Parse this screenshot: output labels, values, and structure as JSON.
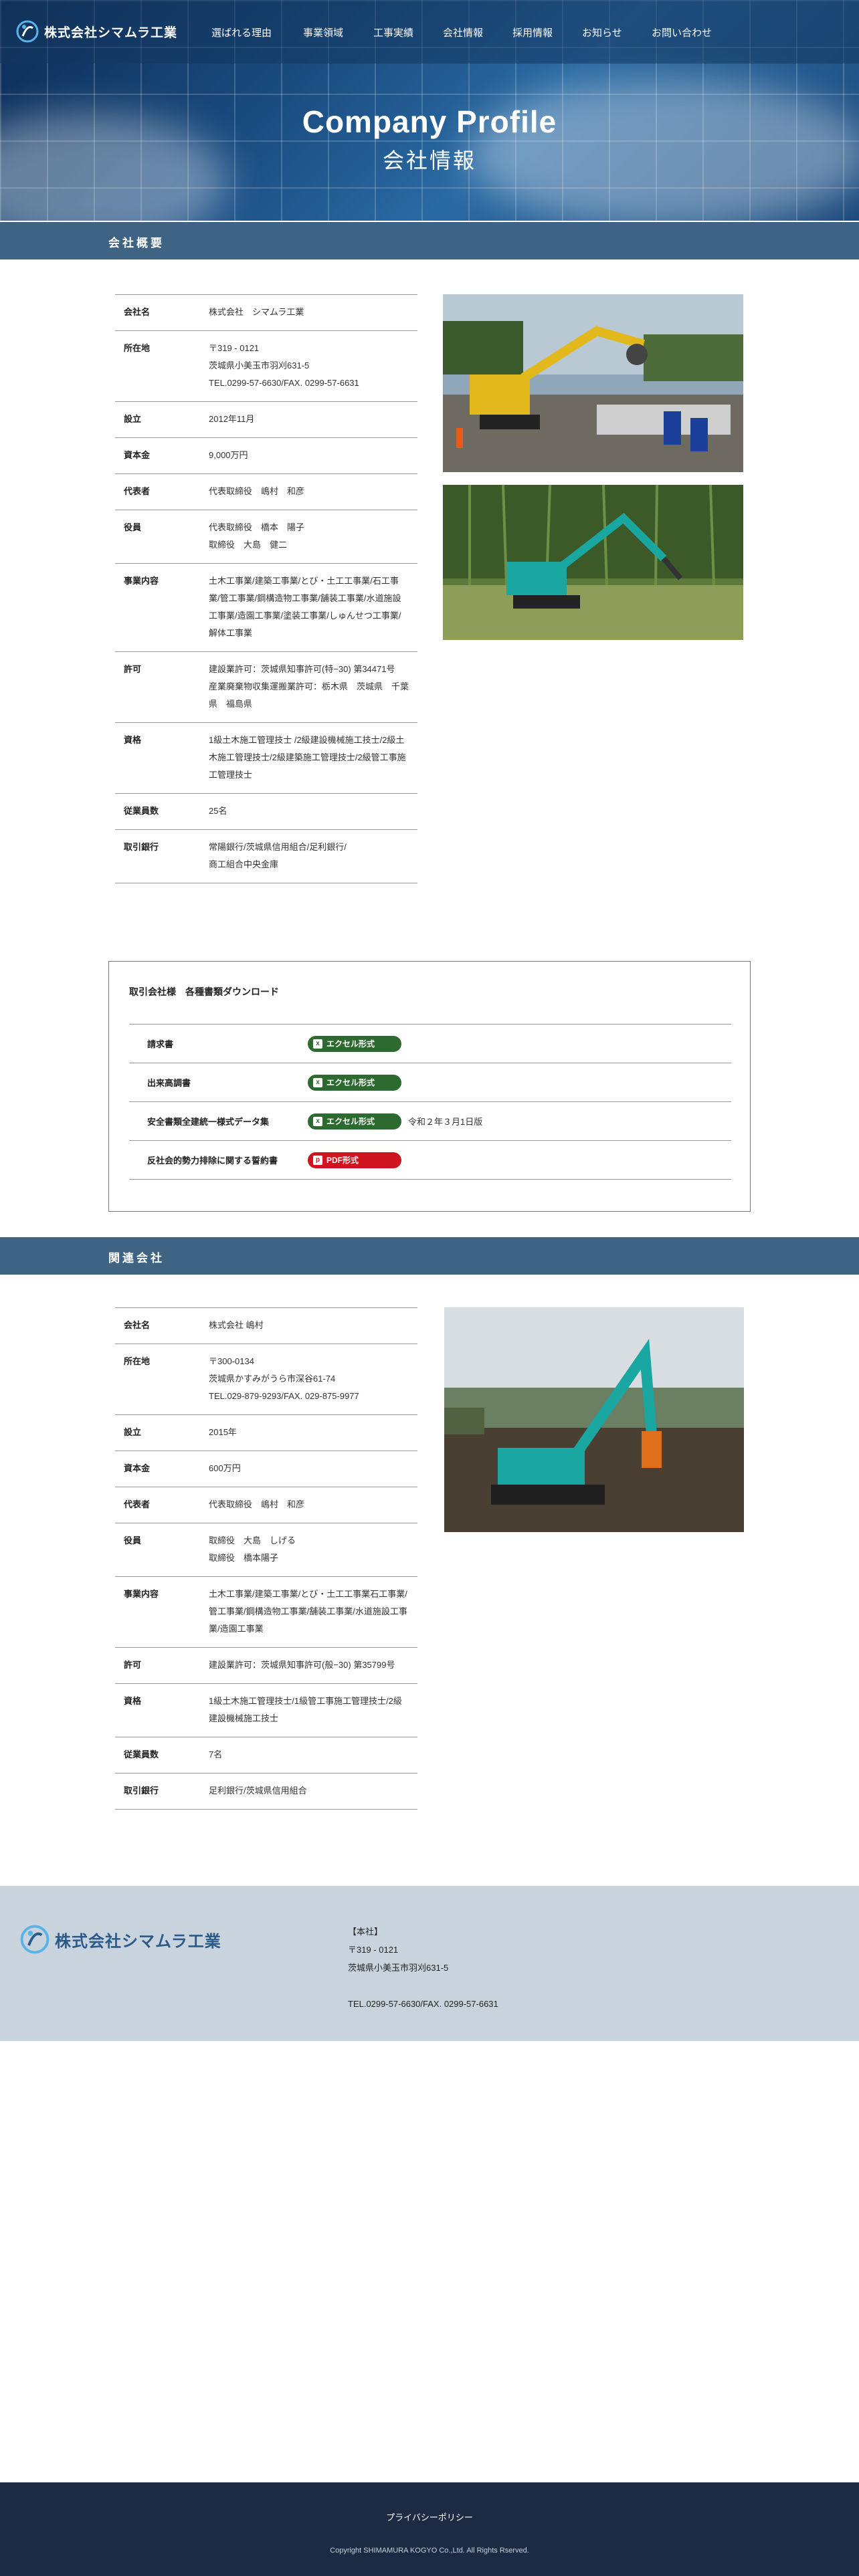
{
  "header": {
    "logo_text": "株式会社シマムラ工業",
    "nav": [
      "選ばれる理由",
      "事業領域",
      "工事実績",
      "会社情報",
      "採用情報",
      "お知らせ",
      "お問い合わせ"
    ]
  },
  "hero": {
    "title": "Company Profile",
    "subtitle": "会社情報"
  },
  "overview": {
    "heading": "会社概要",
    "rows": [
      {
        "k": "会社名",
        "v": "株式会社　シマムラ工業"
      },
      {
        "k": "所在地",
        "v": "〒319 - 0121\n茨城県小美玉市羽刈631-5\nTEL.0299-57-6630/FAX. 0299-57-6631"
      },
      {
        "k": "設立",
        "v": "2012年11月"
      },
      {
        "k": "資本金",
        "v": "9,000万円"
      },
      {
        "k": "代表者",
        "v": "代表取締役　嶋村　和彦"
      },
      {
        "k": "役員",
        "v": "代表取締役　橋本　陽子\n取締役　大島　健二"
      },
      {
        "k": "事業内容",
        "v": "土木工事業/建築工事業/とび・土工工事業/石工事業/管工事業/鋼構造物工事業/舗装工事業/水道施設工事業/造園工事業/塗装工事業/しゅんせつ工事業/解体工事業"
      },
      {
        "k": "許可",
        "v": "建設業許可：茨城県知事許可(特−30) 第34471号\n産業廃棄物収集運搬業許可：栃木県　茨城県　千葉県　福島県"
      },
      {
        "k": "資格",
        "v": "1級土木施工管理技士 /2級建設機械施工技士/2級土木施工管理技士/2級建築施工管理技士/2級管工事施工管理技士"
      },
      {
        "k": "従業員数",
        "v": "25名"
      },
      {
        "k": "取引銀行",
        "v": "常陽銀行/茨城県信用組合/足利銀行/\n商工組合中央金庫"
      }
    ]
  },
  "downloads": {
    "title": "取引会社様　各種書類ダウンロード",
    "items": [
      {
        "name": "請求書",
        "label": "エクセル形式",
        "kind": "green",
        "note": ""
      },
      {
        "name": "出来高調書",
        "label": "エクセル形式",
        "kind": "green",
        "note": ""
      },
      {
        "name": "安全書類全建統一様式データ集",
        "label": "エクセル形式",
        "kind": "green",
        "note": "令和２年３月1日版"
      },
      {
        "name": "反社会的勢力排除に関する誓約書",
        "label": "PDF形式",
        "kind": "red",
        "note": ""
      }
    ]
  },
  "related": {
    "heading": "関連会社",
    "rows": [
      {
        "k": "会社名",
        "v": "株式会社 嶋村"
      },
      {
        "k": "所在地",
        "v": "〒300-0134\n茨城県かすみがうら市深谷61-74\nTEL.029-879-9293/FAX. 029-875-9977"
      },
      {
        "k": "設立",
        "v": "2015年"
      },
      {
        "k": "資本金",
        "v": "600万円"
      },
      {
        "k": "代表者",
        "v": "代表取締役　嶋村　和彦"
      },
      {
        "k": "役員",
        "v": "取締役　大島　しげる\n取締役　橋本陽子"
      },
      {
        "k": "事業内容",
        "v": "土木工事業/建築工事業/とび・土工工事業石工事業/管工事業/鋼構造物工事業/舗装工事業/水道施設工事業/造園工事業"
      },
      {
        "k": "許可",
        "v": "建設業許可：茨城県知事許可(般−30) 第35799号"
      },
      {
        "k": "資格",
        "v": "1級土木施工管理技士/1級管工事施工管理技士/2級建設機械施工技士"
      },
      {
        "k": "従業員数",
        "v": "7名"
      },
      {
        "k": "取引銀行",
        "v": "足利銀行/茨城県信用組合"
      }
    ]
  },
  "footer": {
    "logo_text": "株式会社シマムラ工業",
    "address": "【本社】\n〒319 - 0121\n茨城県小美玉市羽刈631-5\n\nTEL.0299-57-6630/FAX. 0299-57-6631",
    "privacy": "プライバシーポリシー",
    "copyright": "Copyright SHIMAMURA KOGYO Co.,Ltd. All Rights Rserved."
  },
  "colors": {
    "section_header": "#3f6383",
    "excel_green": "#2d6a30",
    "pdf_red": "#d0141f",
    "footer_bg": "#c8d3dd",
    "bottom_bg": "#1d2a44"
  }
}
